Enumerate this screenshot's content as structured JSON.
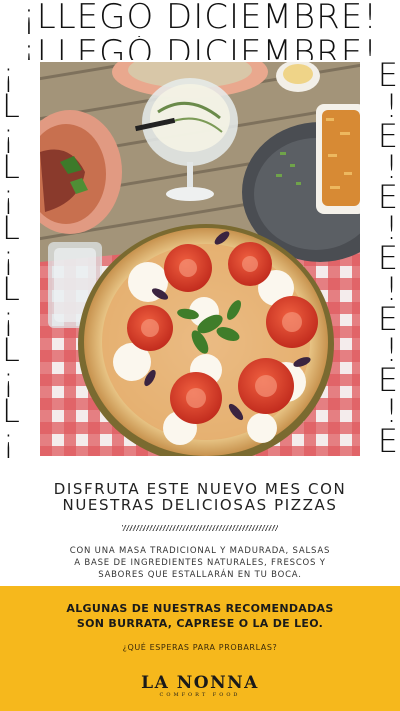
{
  "header": {
    "line1": "¡LLEGO DICIEMBRE!",
    "line2": "¡LLEGÓ DICIEMBRE!"
  },
  "side": {
    "left_glyphs": [
      "¡",
      "L",
      "¡",
      "L",
      "¡",
      "L",
      "¡",
      "L",
      "¡",
      "L",
      "¡",
      "L",
      "¡",
      "L"
    ],
    "right_glyphs": [
      "E",
      "!",
      "E",
      "!",
      "E",
      "!",
      "E",
      "!",
      "E",
      "!",
      "E",
      "!",
      "E",
      "!"
    ]
  },
  "photo": {
    "icon": "pizza-photo"
  },
  "content": {
    "subtitle_line1": "DISFRUTA ESTE NUEVO MES CON",
    "subtitle_line2": "NUESTRAS DELICIOSAS PIZZAS",
    "body_line1": "CON UNA MASA TRADICIONAL Y MADURADA, SALSAS",
    "body_line2": "A BASE DE INGREDIENTES NATURALES,  FRESCOS Y",
    "body_line3": "SABORES QUE ESTALLARÁN EN TU BOCA."
  },
  "band": {
    "title_line1": "ALGUNAS DE NUESTRAS RECOMENDADAS",
    "title_line2": "SON BURRATA, CAPRESE O LA DE LEO.",
    "question": "¿QUÉ ESPERAS PARA PROBARLAS?",
    "logo_name": "LA NONNA",
    "logo_tag": "COMFORT FOOD",
    "color": "#f6b81c"
  }
}
